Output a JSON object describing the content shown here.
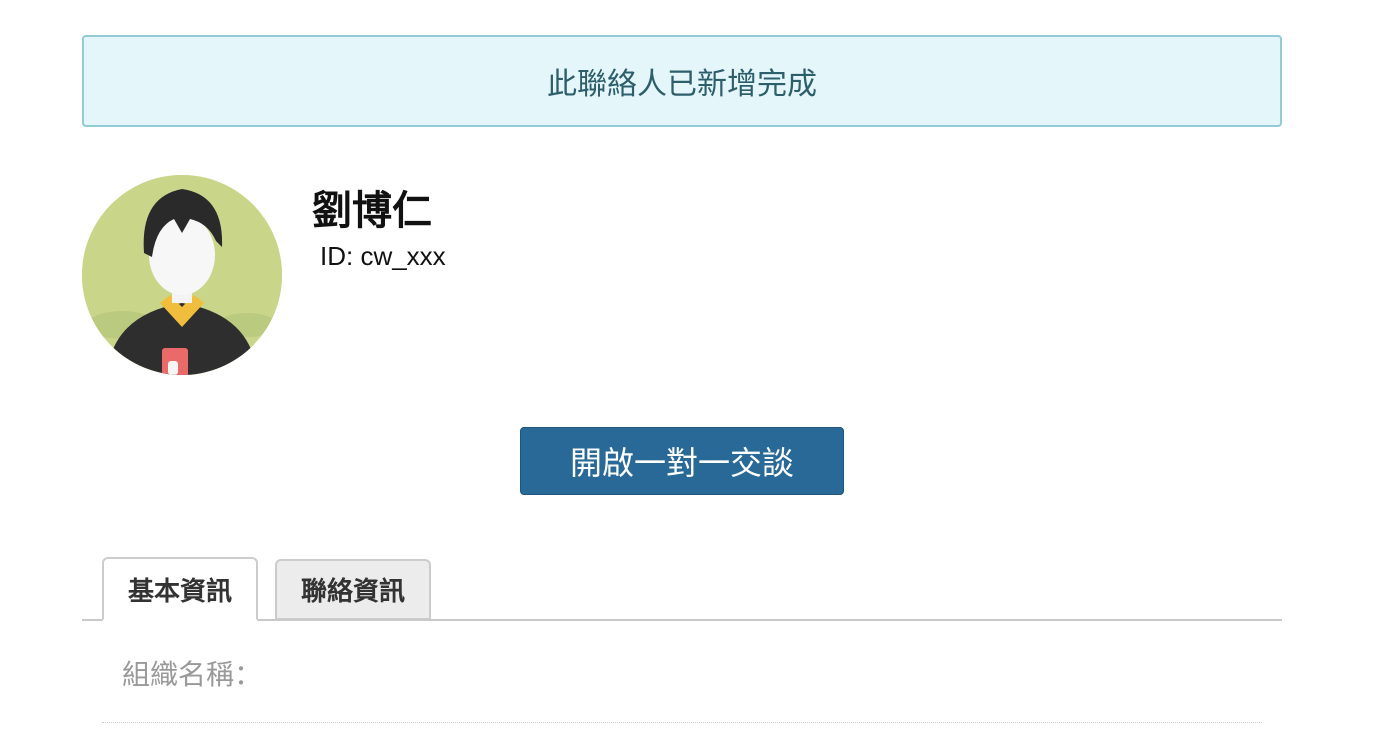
{
  "alert": {
    "message": "此聯絡人已新增完成"
  },
  "contact": {
    "name": "劉博仁",
    "id_text": "ID: cw_xxx",
    "avatar_icon": "person-avatar-icon"
  },
  "actions": {
    "chat_button_label": "開啟一對一交談"
  },
  "tabs": [
    {
      "label": "基本資訊",
      "active": true
    },
    {
      "label": "聯絡資訊",
      "active": false
    }
  ],
  "fields": {
    "organization_label": "組織名稱："
  },
  "colors": {
    "alert_bg": "#e4f6fa",
    "alert_border": "#92cbd6",
    "alert_text": "#2d5e6c",
    "primary_button": "#296997",
    "avatar_bg": "#c9d68a"
  }
}
